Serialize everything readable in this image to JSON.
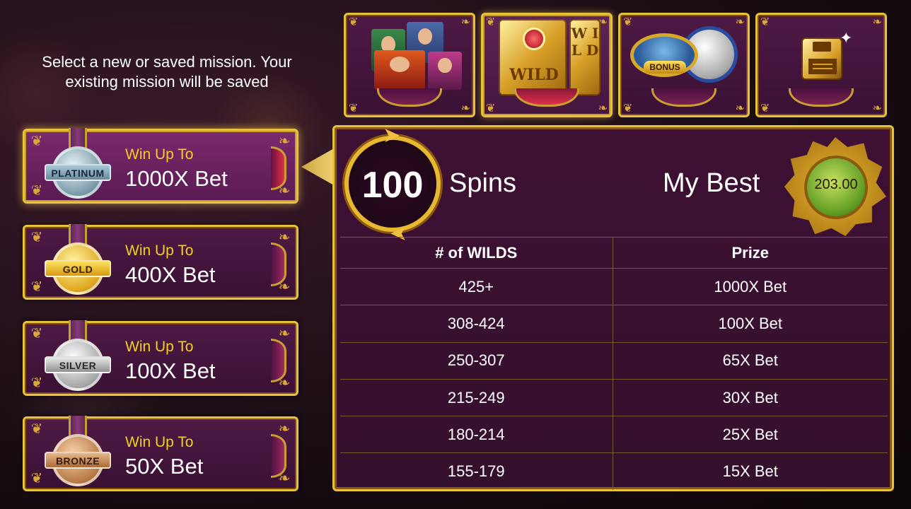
{
  "instructions": "Select a new or saved mission. Your existing mission will be saved",
  "missions": [
    {
      "tier": "PLATINUM",
      "win_label": "Win Up To",
      "win_value": "1000X Bet",
      "selected": true
    },
    {
      "tier": "GOLD",
      "win_label": "Win Up To",
      "win_value": "400X Bet",
      "selected": false
    },
    {
      "tier": "SILVER",
      "win_label": "Win Up To",
      "win_value": "100X Bet",
      "selected": false
    },
    {
      "tier": "BRONZE",
      "win_label": "Win Up To",
      "win_value": "50X Bet",
      "selected": false
    }
  ],
  "tabs": [
    {
      "icon": "characters-icon",
      "active": false
    },
    {
      "icon": "wild-icon",
      "label_a": "WILD",
      "label_b": "W I L D",
      "active": true
    },
    {
      "icon": "bonus-icon",
      "label": "BONUS",
      "active": false
    },
    {
      "icon": "save-icon",
      "active": false
    }
  ],
  "panel": {
    "spins_count": "100",
    "spins_label": "Spins",
    "best_label": "My Best",
    "best_value": "203.00",
    "table": {
      "headers": [
        "# of WILDS",
        "Prize"
      ],
      "rows": [
        [
          "425+",
          "1000X Bet"
        ],
        [
          "308-424",
          "100X Bet"
        ],
        [
          "250-307",
          "65X Bet"
        ],
        [
          "215-249",
          "30X Bet"
        ],
        [
          "180-214",
          "25X Bet"
        ],
        [
          "155-179",
          "15X Bet"
        ]
      ]
    }
  },
  "colors": {
    "gold_border": "#e8c23a",
    "panel_purple": "#3e1034",
    "win_label_yellow": "#f2d020"
  }
}
